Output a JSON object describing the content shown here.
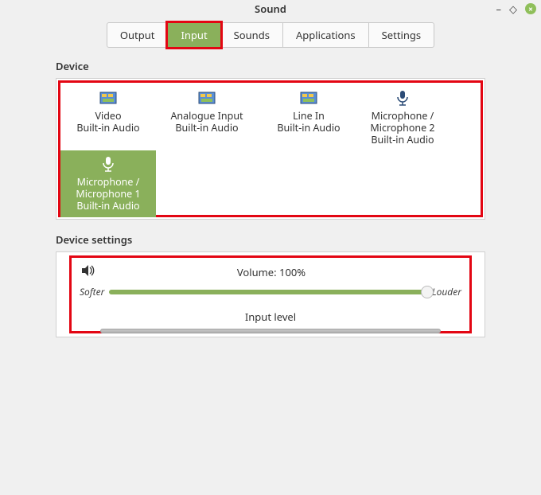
{
  "window": {
    "title": "Sound"
  },
  "tabs": {
    "output": "Output",
    "input": "Input",
    "sounds": "Sounds",
    "applications": "Applications",
    "settings": "Settings"
  },
  "sections": {
    "device_label": "Device",
    "device_settings_label": "Device settings"
  },
  "devices": {
    "video": {
      "line1": "Video",
      "line2": "Built-in Audio"
    },
    "analogue": {
      "line1": "Analogue Input",
      "line2": "Built-in Audio"
    },
    "linein": {
      "line1": "Line In",
      "line2": "Built-in Audio"
    },
    "mic2": {
      "line1": "Microphone /",
      "line2": "Microphone 2",
      "line3": "Built-in Audio"
    },
    "mic1": {
      "line1": "Microphone /",
      "line2": "Microphone 1",
      "line3": "Built-in Audio"
    }
  },
  "volume": {
    "label": "Volume: 100%",
    "softer": "Softer",
    "louder": "Louder",
    "input_level_label": "Input level"
  }
}
